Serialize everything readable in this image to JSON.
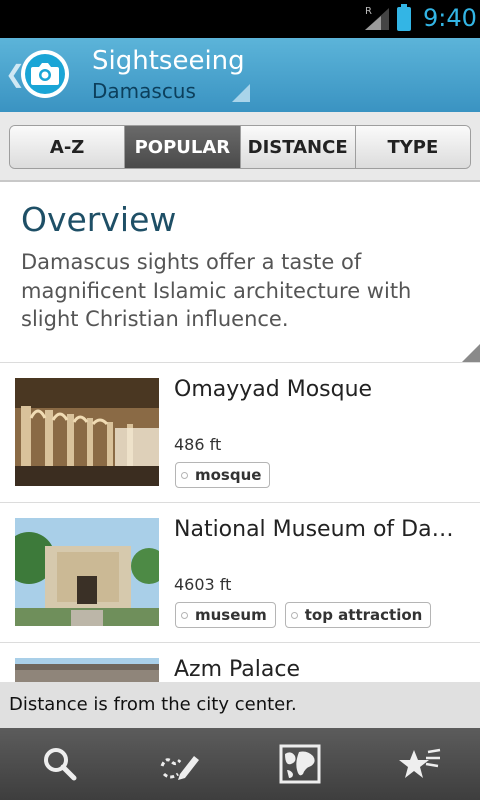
{
  "status_bar": {
    "time": "9:40",
    "signal_label": "R"
  },
  "action_bar": {
    "title": "Sightseeing",
    "subtitle": "Damascus",
    "icon": "camera-icon"
  },
  "tabs": [
    {
      "label": "A-Z",
      "active": false
    },
    {
      "label": "POPULAR",
      "active": true
    },
    {
      "label": "DISTANCE",
      "active": false
    },
    {
      "label": "TYPE",
      "active": false
    }
  ],
  "overview": {
    "title": "Overview",
    "text": "Damascus sights offer a taste of magnificent Islamic architecture with slight Christian influence."
  },
  "list": [
    {
      "title": "Omayyad Mosque",
      "distance": "486 ft",
      "tags": [
        "mosque"
      ]
    },
    {
      "title": "National Museum of Da…",
      "distance": "4603 ft",
      "tags": [
        "museum",
        "top attraction"
      ]
    },
    {
      "title": "Azm Palace",
      "distance": "",
      "tags": []
    }
  ],
  "toast": "Distance is from the city center.",
  "bottom_bar": [
    "search-icon",
    "route-edit-icon",
    "map-icon",
    "favorites-icon"
  ],
  "colors": {
    "accent": "#33b5e5",
    "action_bar": "#4aa3cd",
    "title_blue": "#1e4f66"
  }
}
